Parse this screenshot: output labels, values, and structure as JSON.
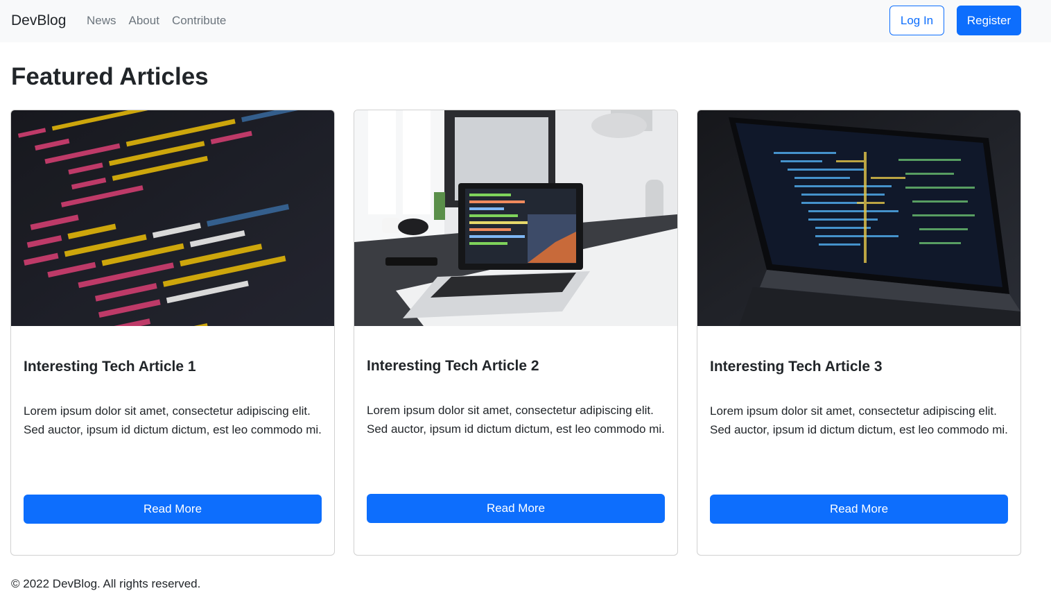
{
  "navbar": {
    "brand": "DevBlog",
    "links": [
      "News",
      "About",
      "Contribute"
    ],
    "login_label": "Log In",
    "register_label": "Register"
  },
  "main": {
    "title": "Featured Articles",
    "cards": [
      {
        "title": "Interesting Tech Article 1",
        "text": "Lorem ipsum dolor sit amet, consectetur adipiscing elit. Sed auctor, ipsum id dictum dictum, est leo commodo mi.",
        "button_label": "Read More",
        "image": "code-closeup-image"
      },
      {
        "title": "Interesting Tech Article 2",
        "text": "Lorem ipsum dolor sit amet, consectetur adipiscing elit. Sed auctor, ipsum id dictum dictum, est leo commodo mi.",
        "button_label": "Read More",
        "image": "laptop-desk-image"
      },
      {
        "title": "Interesting Tech Article 3",
        "text": "Lorem ipsum dolor sit amet, consectetur adipiscing elit. Sed auctor, ipsum id dictum dictum, est leo commodo mi.",
        "button_label": "Read More",
        "image": "dark-laptop-code-image"
      }
    ]
  },
  "footer": {
    "text": "© 2022 DevBlog. All rights reserved."
  },
  "colors": {
    "primary": "#0d6efd",
    "navbar_bg": "#f8f9fa",
    "muted_link": "#6c757d",
    "text": "#212529"
  }
}
